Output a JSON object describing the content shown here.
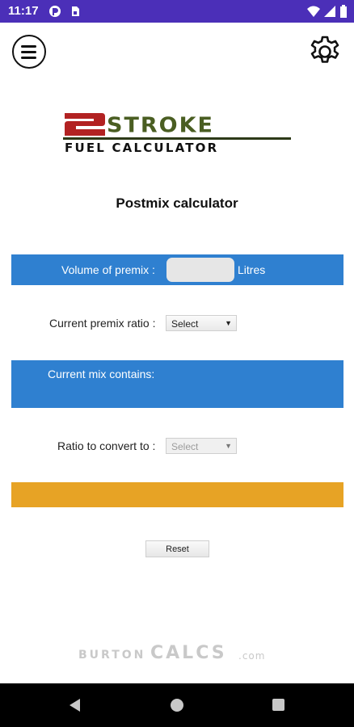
{
  "status_bar": {
    "time": "11:17",
    "icons": [
      "notification-icon",
      "sim-card-icon",
      "wifi-icon",
      "signal-icon",
      "battery-icon"
    ],
    "color": "#4b2fb8"
  },
  "app_bar": {
    "menu_icon": "hamburger-menu-icon",
    "settings_icon": "gear-icon"
  },
  "logo": {
    "numeral": "2",
    "word": "STROKE",
    "subtitle": "FUEL CALCULATOR"
  },
  "page": {
    "title": "Postmix calculator"
  },
  "volume": {
    "label": "Volume of premix :",
    "value": "",
    "placeholder": "",
    "unit": "Litres"
  },
  "current_ratio": {
    "label": "Current premix ratio :",
    "selected": "Select"
  },
  "mix": {
    "label": "Current mix contains:"
  },
  "convert_ratio": {
    "label": "Ratio to convert to :",
    "selected": "Select"
  },
  "actions": {
    "reset_label": "Reset"
  },
  "footer": {
    "brand_a": "BURTON",
    "brand_b": "CALCS",
    "brand_c": ".com"
  },
  "colors": {
    "accent_blue": "#2f80d0",
    "accent_orange": "#e7a325",
    "logo_red": "#b22222",
    "logo_green": "#4a5e22"
  },
  "nav_bar": {
    "icons": [
      "back-icon",
      "home-icon",
      "recent-apps-icon"
    ]
  }
}
